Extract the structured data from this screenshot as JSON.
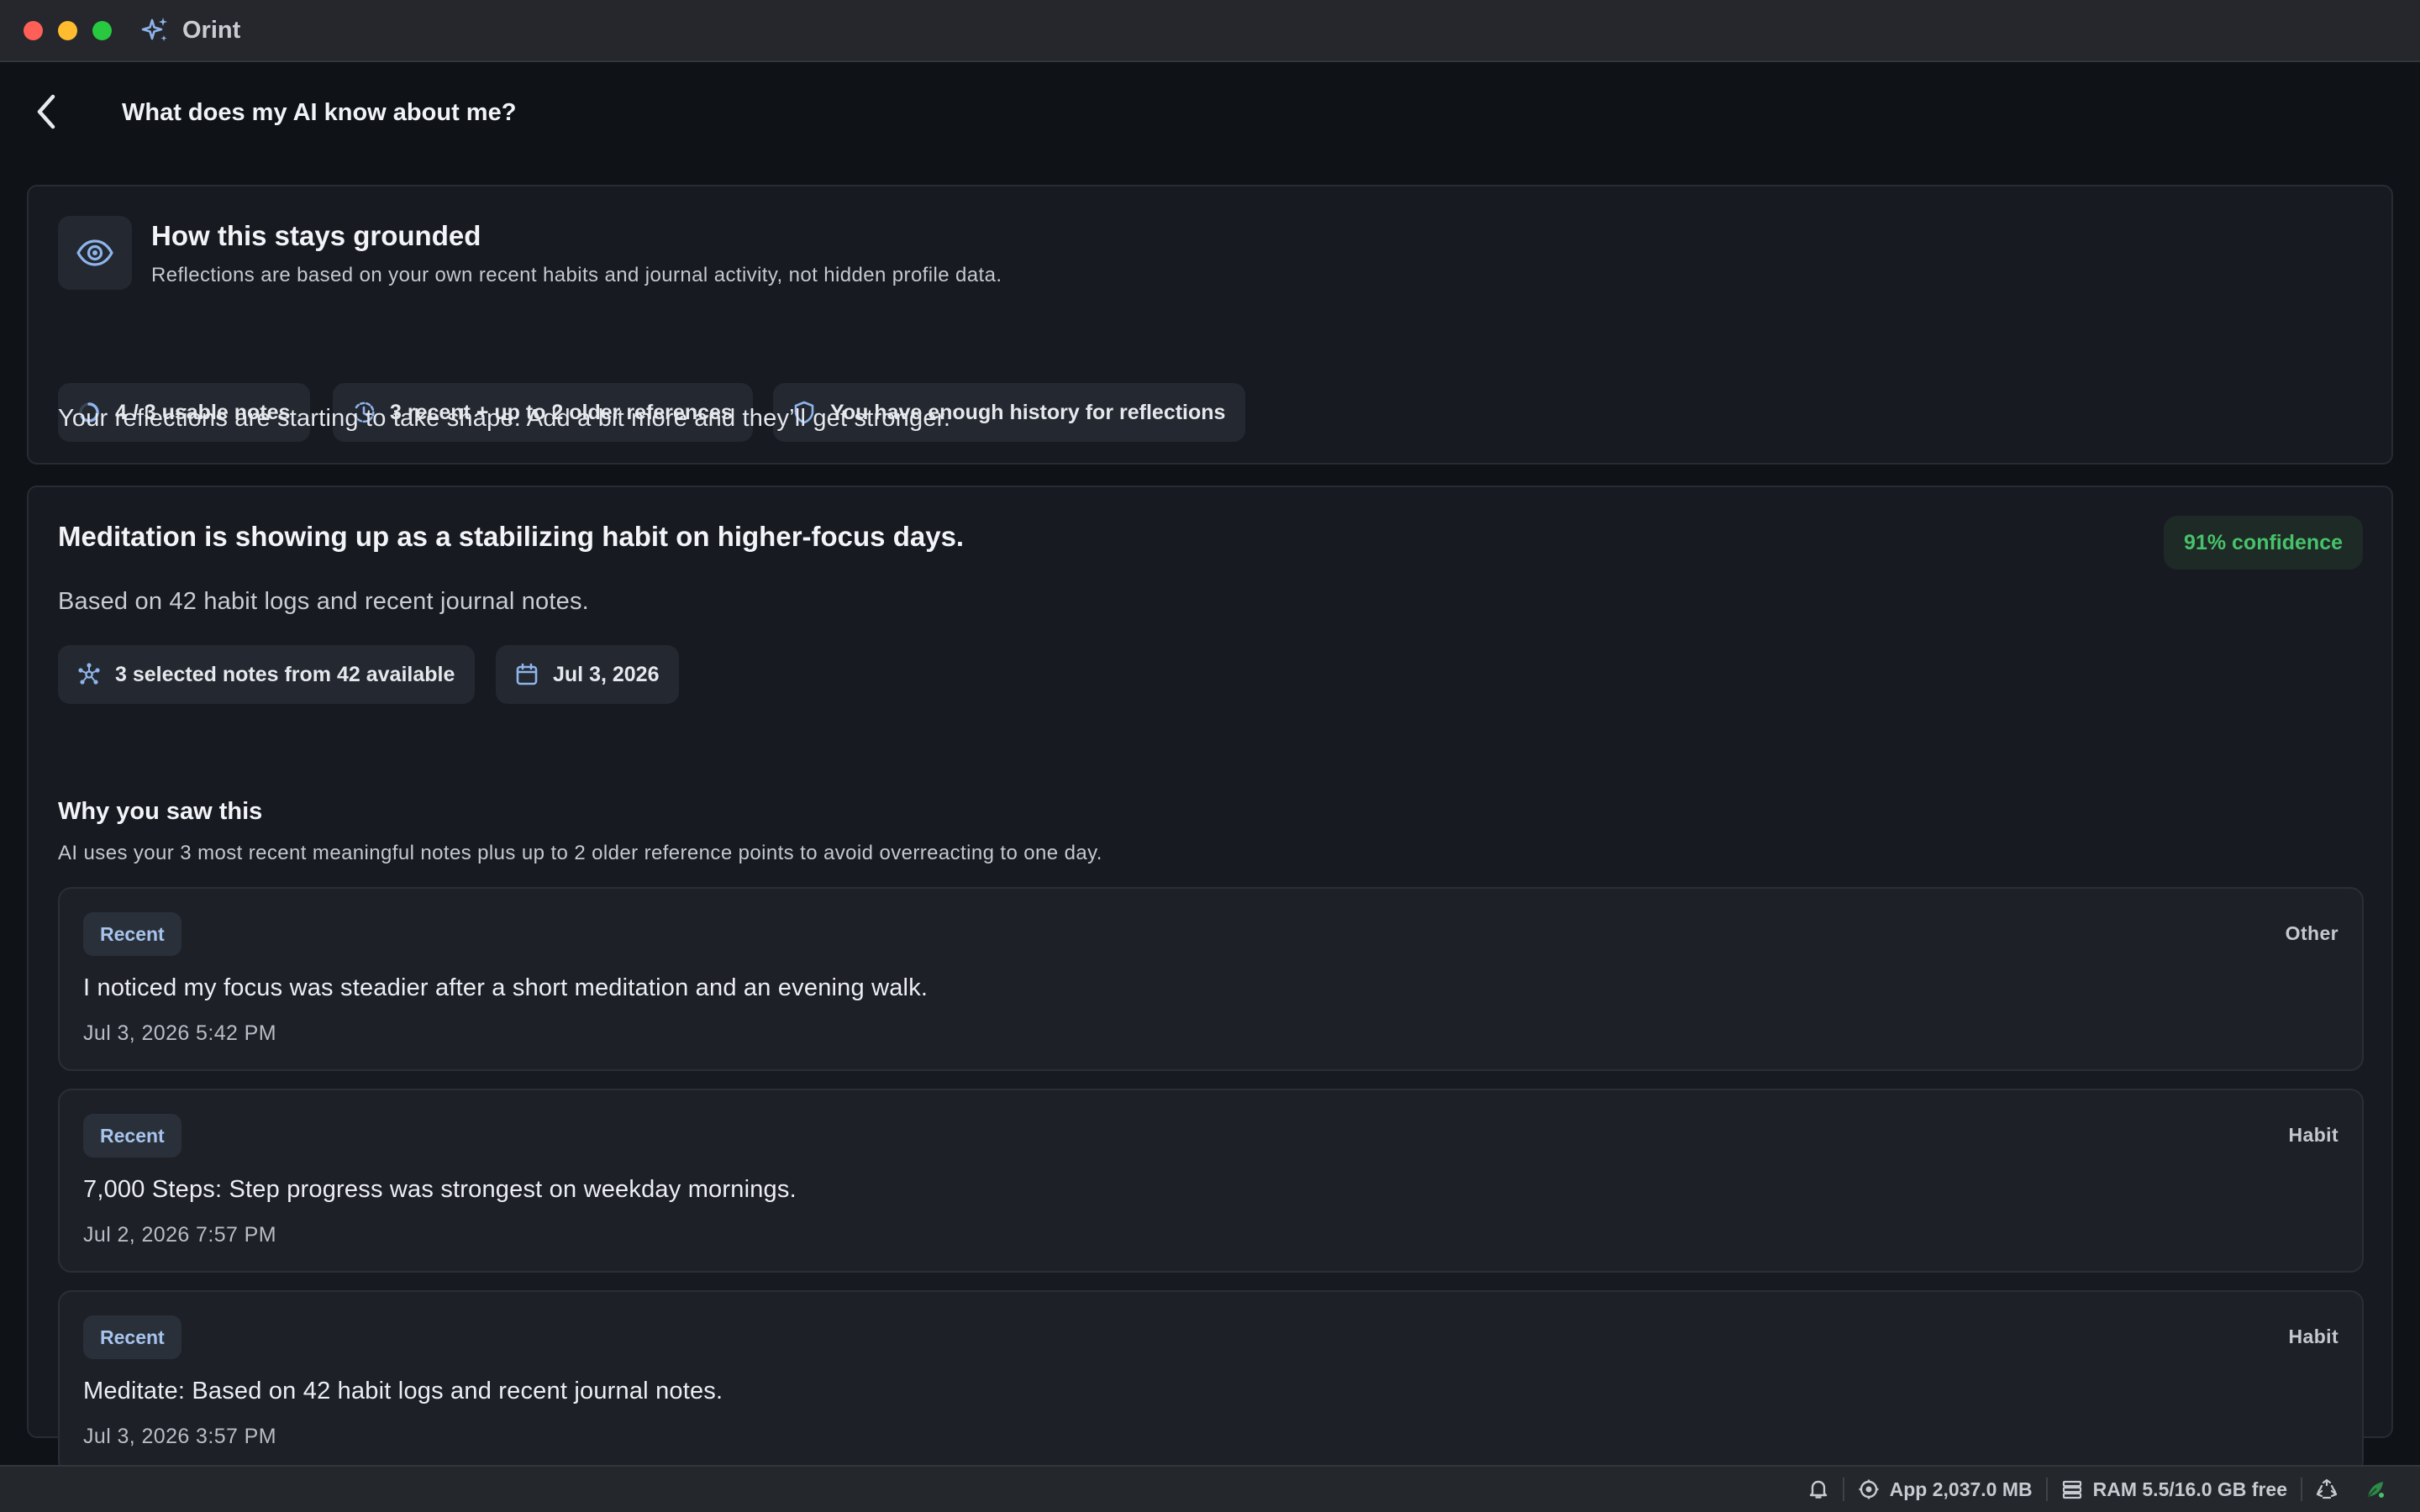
{
  "app": {
    "title": "Orint"
  },
  "header": {
    "title": "What does my AI know about me?"
  },
  "grounded_card": {
    "title": "How this stays grounded",
    "subtitle": "Reflections are based on your own recent habits and journal activity, not hidden profile data.",
    "chips": [
      {
        "label": "4 / 3 usable notes",
        "icon": "progress-ring-icon"
      },
      {
        "label": "3 recent + up to 2 older references",
        "icon": "history-clock-icon"
      },
      {
        "label": "You have enough history for reflections",
        "icon": "shield-icon"
      }
    ],
    "body": "Your reflections are starting to take shape. Add a bit more and they’ll get stronger."
  },
  "insight_card": {
    "title": "Meditation is showing up as a stabilizing habit on higher-focus days.",
    "confidence": "91% confidence",
    "subtitle": "Based on 42 habit logs and recent journal notes.",
    "chips": [
      {
        "label": "3 selected notes from 42 available",
        "icon": "network-icon"
      },
      {
        "label": "Jul 3, 2026",
        "icon": "calendar-icon"
      }
    ],
    "why_title": "Why you saw this",
    "why_subtitle": "AI uses your 3 most recent meaningful notes plus up to 2 older reference points to avoid overreacting to one day.",
    "notes": [
      {
        "badge": "Recent",
        "type": "Other",
        "text": "I noticed my focus was steadier after a short meditation and an evening walk.",
        "time": "Jul 3, 2026 5:42 PM"
      },
      {
        "badge": "Recent",
        "type": "Habit",
        "text": "7,000 Steps: Step progress was strongest on weekday mornings.",
        "time": "Jul 2, 2026 7:57 PM"
      },
      {
        "badge": "Recent",
        "type": "Habit",
        "text": "Meditate: Based on 42 habit logs and recent journal notes.",
        "time": "Jul 3, 2026 3:57 PM"
      }
    ]
  },
  "statusbar": {
    "app_memory": "App 2,037.0 MB",
    "ram": "RAM 5.5/16.0 GB free"
  },
  "colors": {
    "accent_blue": "#8fb4ea",
    "confidence_green": "#47c26a",
    "background": "#0f1217",
    "card": "#171a21"
  }
}
